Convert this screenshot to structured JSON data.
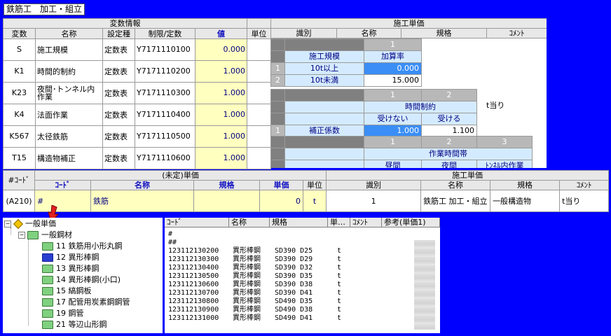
{
  "window_title": "鉄筋工　加工・組立",
  "vars": {
    "group_header": "変数情報",
    "columns": [
      "変数",
      "名称",
      "設定種",
      "制限/定数",
      "値",
      "単位"
    ],
    "rows": [
      {
        "var": "S",
        "name": "施工規模",
        "type": "定数表",
        "code": "Y7171110100",
        "value": "0.000",
        "unit": ""
      },
      {
        "var": "K1",
        "name": "時間的制約",
        "type": "定数表",
        "code": "Y7171110200",
        "value": "1.000",
        "unit": ""
      },
      {
        "var": "K23",
        "name": "夜間･トンネル内作業",
        "type": "定数表",
        "code": "Y7171110300",
        "value": "1.000",
        "unit": ""
      },
      {
        "var": "K4",
        "name": "法面作業",
        "type": "定数表",
        "code": "Y7171110400",
        "value": "1.000",
        "unit": ""
      },
      {
        "var": "K567",
        "name": "太径鉄筋",
        "type": "定数表",
        "code": "Y7171110500",
        "value": "1.000",
        "unit": ""
      },
      {
        "var": "T15",
        "name": "構造物補正",
        "type": "定数表",
        "code": "Y7171110600",
        "value": "1.000",
        "unit": ""
      }
    ]
  },
  "unitprice": {
    "group_header": "施工単価",
    "columns": [
      "識別",
      "名称",
      "規格",
      "ｺﾒﾝﾄ"
    ],
    "comment": "t当り",
    "sub1": {
      "col_num": "1",
      "row_label": "施工規模",
      "col_label": "加算率",
      "rows": [
        {
          "num": "1",
          "label": "10t以上",
          "value": "0.000"
        },
        {
          "num": "2",
          "label": "10t未満",
          "value": "15.000"
        }
      ]
    },
    "sub2": {
      "col_nums": [
        "1",
        "2"
      ],
      "group_label": "時間制約",
      "col_labels": [
        "受けない",
        "受ける"
      ],
      "row": {
        "num": "1",
        "label": "補正係数",
        "values": [
          "1.000",
          "1.100"
        ]
      }
    },
    "sub3": {
      "col_nums": [
        "1",
        "2",
        "3"
      ],
      "group_label": "作業時間帯",
      "col_labels": [
        "昼間",
        "夜間",
        "ﾄﾝﾈﾙ内作業"
      ]
    }
  },
  "mid": {
    "col_code": "#ｺｰﾄﾞ",
    "undefined_header": "(未定)単価",
    "undef_columns": [
      "ｺｰﾄﾞ",
      "名称",
      "規格",
      "単価",
      "単位"
    ],
    "unit_header": "施工単価",
    "unit_columns": [
      "識別",
      "名称",
      "規格",
      "ｺﾒﾝﾄ"
    ],
    "row": {
      "code": "(A210)",
      "u_code": "#",
      "u_name": "鉄筋",
      "u_spec": "",
      "u_price": "0",
      "u_unit": "t",
      "id": "1",
      "name": "鉄筋工 加工・組立",
      "spec": "一般構造物",
      "comment": "t当り"
    }
  },
  "tree": {
    "root": "一般単価",
    "child": "一般鋼材",
    "items": [
      "11 鉄筋用小形丸鋼",
      "12 異形棒鋼",
      "13 異形棒鋼",
      "14 異形棒鋼(小口)",
      "15 縞鋼板",
      "17 配管用炭素鋼鋼管",
      "19 鋼管",
      "21 等辺山形鋼"
    ]
  },
  "list": {
    "columns": [
      "ｺｰﾄﾞ",
      "名称",
      "規格",
      "単…",
      "ｺﾒﾝﾄ",
      "参考(単価1)"
    ],
    "rows": [
      {
        "code": "#",
        "name": "",
        "spec": "",
        "unit": ""
      },
      {
        "code": "##",
        "name": "",
        "spec": "",
        "unit": ""
      },
      {
        "code": "123112130200",
        "name": "異形棒鋼",
        "spec": "SD390  D25",
        "unit": "t"
      },
      {
        "code": "123112130300",
        "name": "異形棒鋼",
        "spec": "SD390  D29",
        "unit": "t"
      },
      {
        "code": "123112130400",
        "name": "異形棒鋼",
        "spec": "SD390  D32",
        "unit": "t"
      },
      {
        "code": "123112130500",
        "name": "異形棒鋼",
        "spec": "SD390  D35",
        "unit": "t"
      },
      {
        "code": "123112130600",
        "name": "異形棒鋼",
        "spec": "SD390  D38",
        "unit": "t"
      },
      {
        "code": "123112130700",
        "name": "異形棒鋼",
        "spec": "SD390  D41",
        "unit": "t"
      },
      {
        "code": "123112130800",
        "name": "異形棒鋼",
        "spec": "SD490  D35",
        "unit": "t"
      },
      {
        "code": "123112130900",
        "name": "異形棒鋼",
        "spec": "SD490  D38",
        "unit": "t"
      },
      {
        "code": "123112131000",
        "name": "異形棒鋼",
        "spec": "SD490  D41",
        "unit": "t"
      }
    ]
  }
}
